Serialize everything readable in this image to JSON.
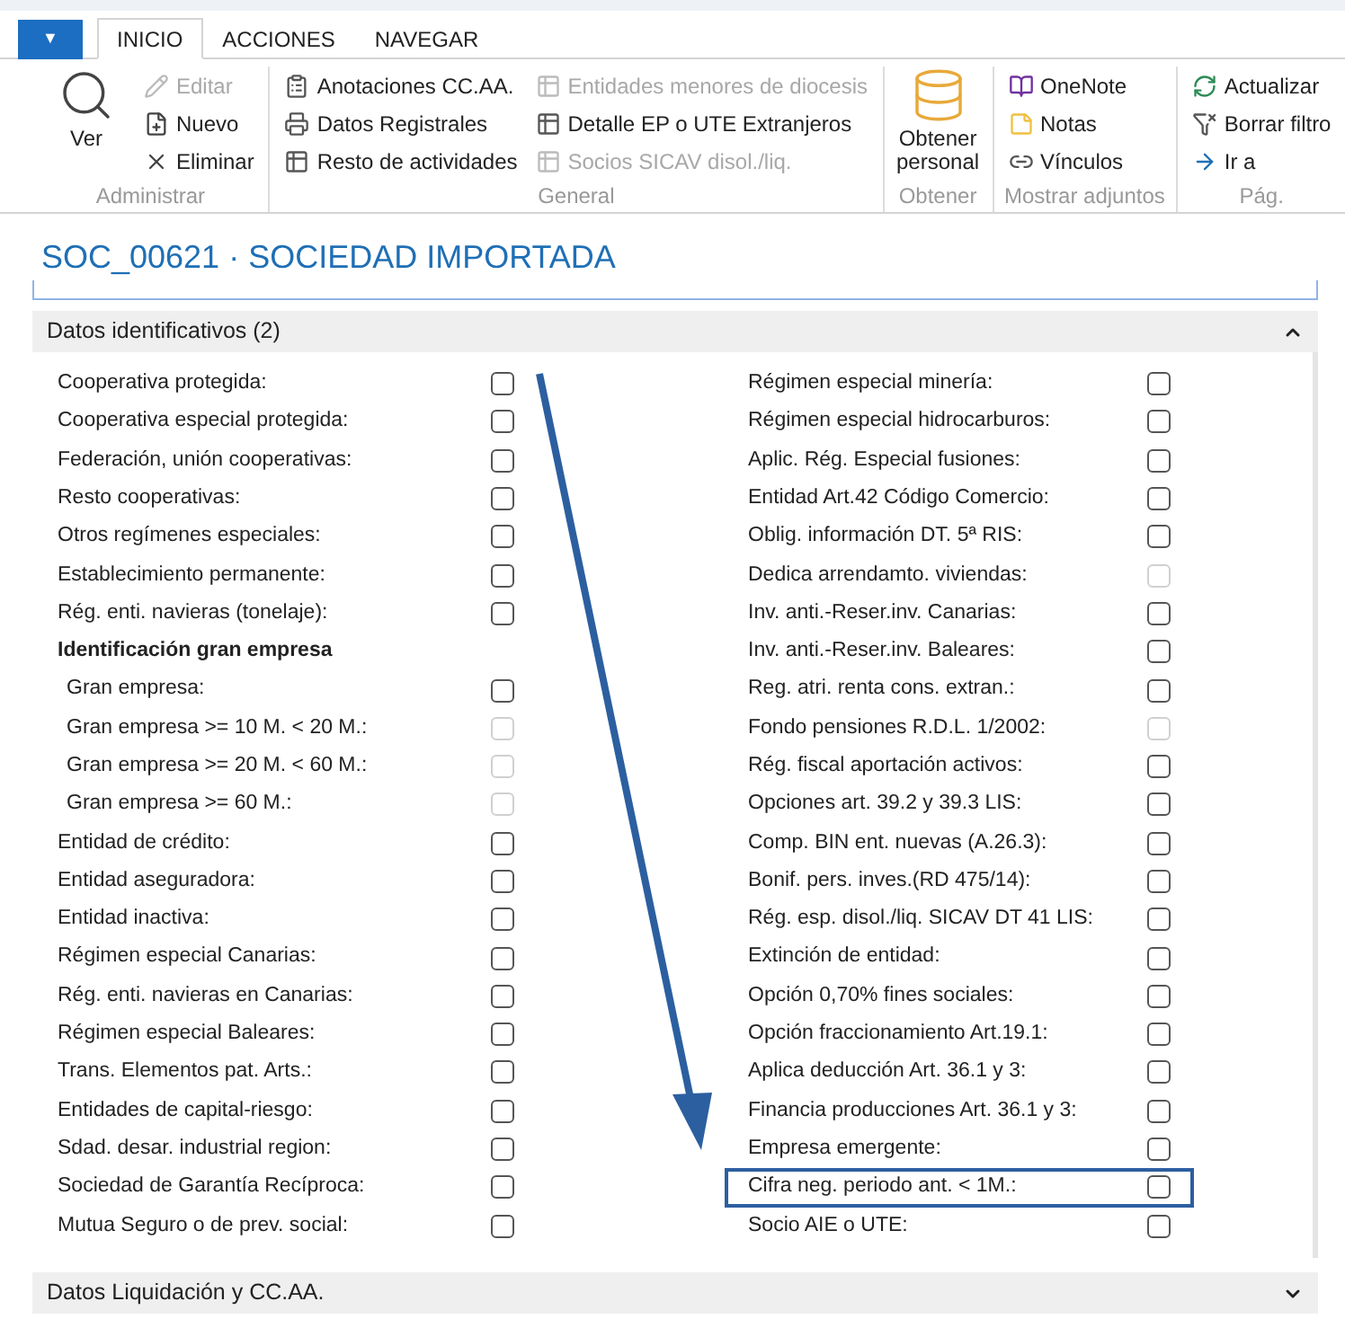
{
  "ribbon": {
    "menu_button": {
      "label": "▼"
    },
    "tabs": [
      {
        "label": "INICIO",
        "selected": true
      },
      {
        "label": "ACCIONES",
        "selected": false
      },
      {
        "label": "NAVEGAR",
        "selected": false
      }
    ],
    "groups": [
      {
        "label": "Administrar",
        "large": [
          {
            "label": "Ver",
            "disabled": false
          }
        ],
        "columns": [
          [
            {
              "label": "Editar",
              "disabled": true
            },
            {
              "label": "Nuevo",
              "disabled": false
            },
            {
              "label": "Eliminar",
              "disabled": false
            }
          ]
        ]
      },
      {
        "label": "General",
        "columns": [
          [
            {
              "label": "Anotaciones CC.AA.",
              "disabled": false
            },
            {
              "label": "Datos Registrales",
              "disabled": false
            },
            {
              "label": "Resto de actividades",
              "disabled": false
            }
          ],
          [
            {
              "label": "Entidades menores de diocesis",
              "disabled": true
            },
            {
              "label": "Detalle EP o UTE Extranjeros",
              "disabled": false
            },
            {
              "label": "Socios SICAV disol./liq.",
              "disabled": true
            }
          ]
        ]
      },
      {
        "label": "Obtener",
        "large": [
          {
            "label": "Obtener personal",
            "disabled": false
          }
        ]
      },
      {
        "label": "Mostrar adjuntos",
        "columns": [
          [
            {
              "label": "OneNote",
              "disabled": false
            },
            {
              "label": "Notas",
              "disabled": false
            },
            {
              "label": "Vínculos",
              "disabled": false
            }
          ]
        ]
      },
      {
        "label": "Pág.",
        "columns": [
          [
            {
              "label": "Actualizar",
              "disabled": false
            },
            {
              "label": "Borrar filtro",
              "disabled": false
            },
            {
              "label": "Ir a",
              "disabled": false
            }
          ]
        ]
      }
    ]
  },
  "page_title": "SOC_00621 · SOCIEDAD IMPORTADA",
  "sections": [
    {
      "title": "Datos identificativos (2)",
      "expanded": true,
      "left": [
        {
          "kind": "checkbox",
          "label": "Cooperativa protegida:",
          "disabled": false,
          "highlighted": false
        },
        {
          "kind": "checkbox",
          "label": "Cooperativa especial protegida:",
          "disabled": false,
          "highlighted": false
        },
        {
          "kind": "checkbox",
          "label": "Federación, unión cooperativas:",
          "disabled": false,
          "highlighted": false
        },
        {
          "kind": "checkbox",
          "label": "Resto cooperativas:",
          "disabled": false,
          "highlighted": false
        },
        {
          "kind": "checkbox",
          "label": "Otros regímenes especiales:",
          "disabled": false,
          "highlighted": false
        },
        {
          "kind": "checkbox",
          "label": "Establecimiento permanente:",
          "disabled": false,
          "highlighted": false
        },
        {
          "kind": "checkbox",
          "label": "Rég. enti. navieras (tonelaje):",
          "disabled": false,
          "highlighted": false
        },
        {
          "kind": "heading",
          "label": "Identificación gran empresa",
          "children": [
            {
              "kind": "checkbox",
              "label": "Gran empresa:",
              "disabled": false,
              "highlighted": false
            },
            {
              "kind": "checkbox",
              "label": "Gran empresa >= 10 M. < 20 M.:",
              "disabled": true,
              "highlighted": false
            },
            {
              "kind": "checkbox",
              "label": "Gran empresa >= 20 M. < 60 M.:",
              "disabled": true,
              "highlighted": false
            },
            {
              "kind": "checkbox",
              "label": "Gran empresa >= 60 M.:",
              "disabled": true,
              "highlighted": false
            }
          ]
        },
        {
          "kind": "checkbox",
          "label": "Entidad de crédito:",
          "disabled": false,
          "highlighted": false
        },
        {
          "kind": "checkbox",
          "label": "Entidad aseguradora:",
          "disabled": false,
          "highlighted": false
        },
        {
          "kind": "checkbox",
          "label": "Entidad inactiva:",
          "disabled": false,
          "highlighted": false
        },
        {
          "kind": "checkbox",
          "label": "Régimen especial Canarias:",
          "disabled": false,
          "highlighted": false
        },
        {
          "kind": "checkbox",
          "label": "Rég. enti. navieras en Canarias:",
          "disabled": false,
          "highlighted": false
        },
        {
          "kind": "checkbox",
          "label": "Régimen especial Baleares:",
          "disabled": false,
          "highlighted": false
        },
        {
          "kind": "checkbox",
          "label": "Trans. Elementos pat. Arts.:",
          "disabled": false,
          "highlighted": false
        },
        {
          "kind": "checkbox",
          "label": "Entidades de capital-riesgo:",
          "disabled": false,
          "highlighted": false
        },
        {
          "kind": "checkbox",
          "label": "Sdad. desar. industrial region:",
          "disabled": false,
          "highlighted": false
        },
        {
          "kind": "checkbox",
          "label": "Sociedad de Garantía Recíproca:",
          "disabled": false,
          "highlighted": false
        },
        {
          "kind": "checkbox",
          "label": "Mutua Seguro o de prev. social:",
          "disabled": false,
          "highlighted": false
        }
      ],
      "right": [
        {
          "kind": "checkbox",
          "label": "Régimen especial minería:",
          "disabled": false,
          "highlighted": false
        },
        {
          "kind": "checkbox",
          "label": "Régimen especial hidrocarburos:",
          "disabled": false,
          "highlighted": false
        },
        {
          "kind": "checkbox",
          "label": "Aplic. Rég. Especial fusiones:",
          "disabled": false,
          "highlighted": false
        },
        {
          "kind": "checkbox",
          "label": "Entidad Art.42 Código Comercio:",
          "disabled": false,
          "highlighted": false
        },
        {
          "kind": "checkbox",
          "label": "Oblig. información DT. 5ª RIS:",
          "disabled": false,
          "highlighted": false
        },
        {
          "kind": "checkbox",
          "label": "Dedica arrendamto. viviendas:",
          "disabled": true,
          "highlighted": false
        },
        {
          "kind": "checkbox",
          "label": "Inv. anti.-Reser.inv. Canarias:",
          "disabled": false,
          "highlighted": false
        },
        {
          "kind": "checkbox",
          "label": "Inv. anti.-Reser.inv. Baleares:",
          "disabled": false,
          "highlighted": false
        },
        {
          "kind": "checkbox",
          "label": "Reg. atri. renta cons. extran.:",
          "disabled": false,
          "highlighted": false
        },
        {
          "kind": "checkbox",
          "label": "Fondo pensiones R.D.L. 1/2002:",
          "disabled": true,
          "highlighted": false
        },
        {
          "kind": "checkbox",
          "label": "Rég. fiscal aportación activos:",
          "disabled": false,
          "highlighted": false
        },
        {
          "kind": "checkbox",
          "label": "Opciones art. 39.2 y 39.3 LIS:",
          "disabled": false,
          "highlighted": false
        },
        {
          "kind": "checkbox",
          "label": "Comp. BIN ent. nuevas (A.26.3):",
          "disabled": false,
          "highlighted": false
        },
        {
          "kind": "checkbox",
          "label": "Bonif. pers. inves.(RD 475/14):",
          "disabled": false,
          "highlighted": false
        },
        {
          "kind": "checkbox",
          "label": "Rég. esp. disol./liq. SICAV DT 41 LIS:",
          "disabled": false,
          "highlighted": false
        },
        {
          "kind": "checkbox",
          "label": "Extinción de entidad:",
          "disabled": false,
          "highlighted": false
        },
        {
          "kind": "checkbox",
          "label": "Opción 0,70% fines sociales:",
          "disabled": false,
          "highlighted": false
        },
        {
          "kind": "checkbox",
          "label": "Opción fraccionamiento Art.19.1:",
          "disabled": false,
          "highlighted": false
        },
        {
          "kind": "checkbox",
          "label": "Aplica deducción Art. 36.1 y 3:",
          "disabled": false,
          "highlighted": false
        },
        {
          "kind": "checkbox",
          "label": "Financia producciones Art. 36.1 y 3:",
          "disabled": false,
          "highlighted": false
        },
        {
          "kind": "checkbox",
          "label": "Empresa emergente:",
          "disabled": false,
          "highlighted": false
        },
        {
          "kind": "checkbox",
          "label": "Cifra neg. periodo ant. < 1M.:",
          "disabled": false,
          "highlighted": true
        },
        {
          "kind": "checkbox",
          "label": "Socio AIE o UTE:",
          "disabled": false,
          "highlighted": false
        }
      ]
    },
    {
      "title": "Datos Liquidación y CC.AA.",
      "expanded": false
    }
  ]
}
